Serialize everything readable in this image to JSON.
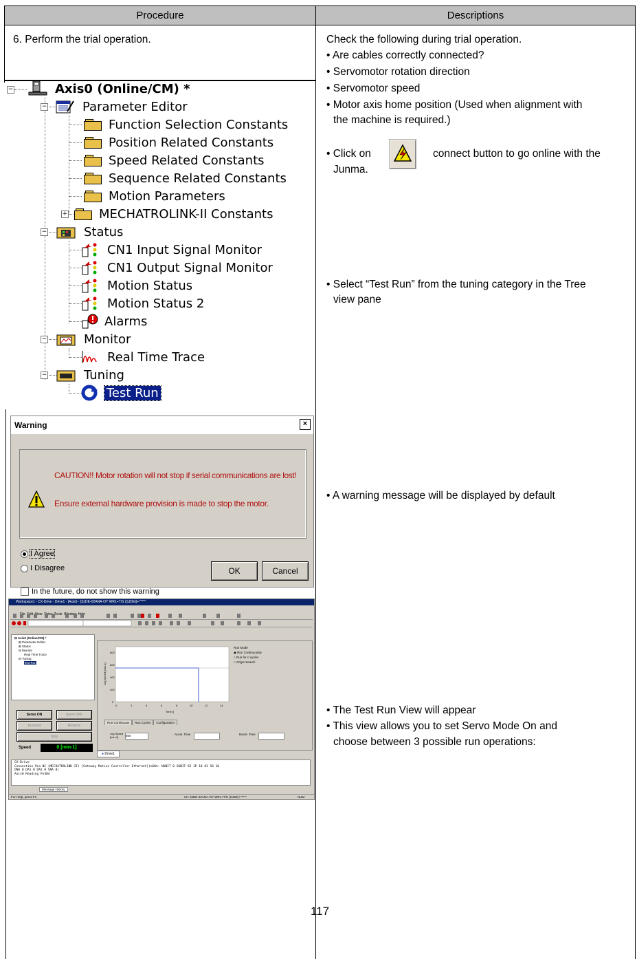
{
  "headers": {
    "procedure": "Procedure",
    "descriptions": "Descriptions"
  },
  "step": "6. Perform the trial operation.",
  "check_intro": "Check the following during trial operation.",
  "checks": [
    "• Are cables correctly connected?",
    "• Servomotor rotation direction",
    "• Servomotor speed",
    "• Motor axis home position (Used when alignment with",
    "the machine is required.)"
  ],
  "connect": {
    "pre": "• Click on",
    "post": "connect button to go online with the",
    "post2": "Junma."
  },
  "select_test_run": [
    "• Select “Test Run” from the tuning category in the Tree",
    "view pane"
  ],
  "warning_note": "• A warning message will be displayed by default",
  "test_run_notes": [
    "• The Test Run View will appear",
    "• This view allows you to set Servo Mode On and",
    "choose between 3 possible run operations:"
  ],
  "page_number": "117",
  "tree": {
    "root": "Axis0 (Online/CM) *",
    "parameter_editor": "Parameter Editor",
    "function_selection": "Function Selection Constants",
    "position_related": "Position Related Constants",
    "speed_related": "Speed Related Constants",
    "sequence_related": "Sequence Related Constants",
    "motion_parameters": "Motion Parameters",
    "mechatrolink": "MECHATROLINK-II Constants",
    "status": "Status",
    "cn1_input": "CN1 Input Signal Monitor",
    "cn1_output": "CN1 Output Signal Monitor",
    "motion_status": "Motion Status",
    "motion_status2": "Motion Status 2",
    "alarms": "Alarms",
    "monitor": "Monitor",
    "real_time_trace": "Real Time Trace",
    "tuning": "Tuning",
    "test_run": "Test Run"
  },
  "dialog": {
    "title": "Warning",
    "line1": "CAUTION!! Motor rotation will not stop if serial communications are lost!",
    "line2": "Ensure external hardware provision is made to stop the motor.",
    "agree": "I Agree",
    "disagree": "I Disagree",
    "future": "In the future, do not show this warning",
    "ok": "OK",
    "cancel": "Cancel"
  },
  "app": {
    "title": "Workspace1 - CX-Drive - Drive1 - [Axis0 - [SJDE-02ANA-OY WR1+T/S (SJDE)]+*****",
    "menu": "File  Edit  View  Drive  Tools  Window  Help",
    "servo_on": "Servo ON",
    "servo_off": "Servo OFF",
    "forward": "Forward",
    "reverse": "Reverse",
    "stop": "Stop",
    "speed_label": "Speed",
    "speed_value": "0 [min-1]",
    "tabs": [
      "Run Continuous",
      "Run Cycles",
      "Configuration"
    ],
    "run_mode_title": "Run Mode",
    "run_modes": [
      "Run Continuously",
      "Run for n cycles",
      "Origin Search"
    ],
    "y_label": "Jog Speed [min-1]",
    "x_label": "Time []",
    "yticks": [
      "800",
      "600",
      "400",
      "200",
      "0"
    ],
    "xticks": [
      "0",
      "2",
      "4",
      "6",
      "8",
      "10",
      "12",
      "14"
    ],
    "jog_speed": "Jog Speed [min-1]",
    "jog_value": "500",
    "accel": "Accel. Time",
    "decel": "Decel. Time",
    "drive_tab": "Drive1",
    "log": [
      "CX-Drive",
      "Connection Via NC (MECHATROLINK-II) [Gateway Motion Controller Ethernet](%60%: NUNIT 0 SUNIT 65 IP 10 83 50 10",
      "DNA 0 DA1 0 DA2 0 SNA 0)",
      "Axis0 Reading Pn304"
    ],
    "log_tab": "Message History",
    "status_left": "For Help, press F1",
    "status_mid": "CH   SJDE-02ANA-OY WR1+T/S (SJDE)+*****",
    "status_right": "NUM"
  }
}
